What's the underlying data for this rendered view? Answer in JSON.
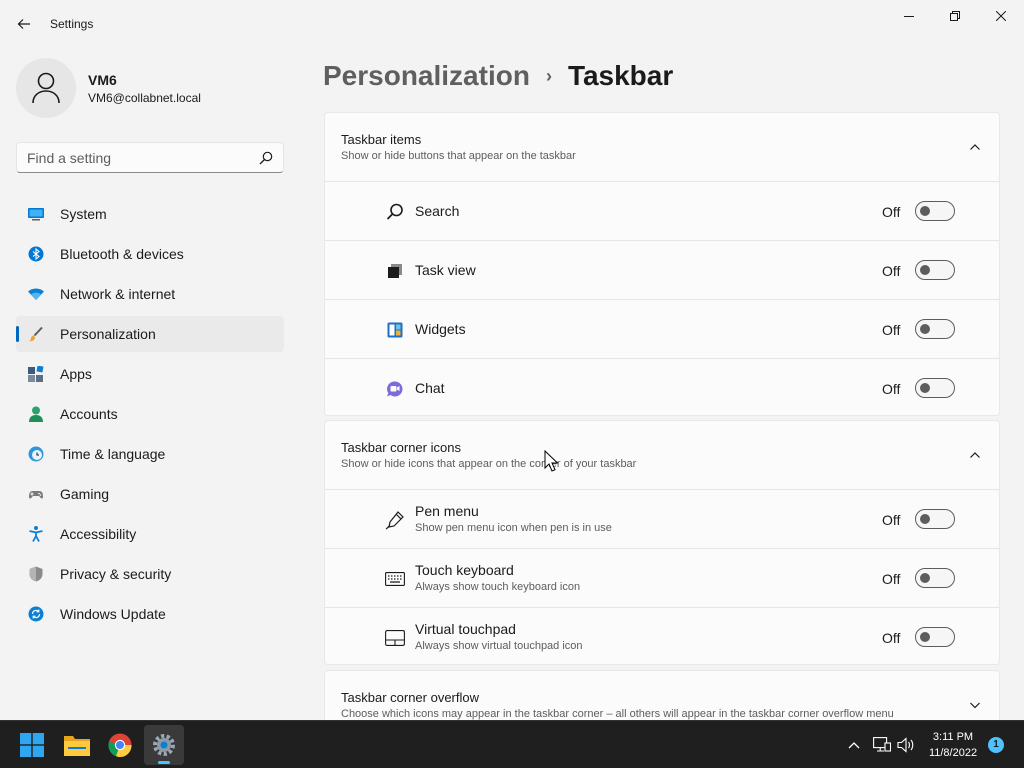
{
  "window": {
    "title": "Settings"
  },
  "profile": {
    "name": "VM6",
    "email": "VM6@collabnet.local"
  },
  "search": {
    "placeholder": "Find a setting"
  },
  "nav": {
    "items": [
      {
        "label": "System",
        "icon": "monitor-icon"
      },
      {
        "label": "Bluetooth & devices",
        "icon": "bluetooth-icon"
      },
      {
        "label": "Network & internet",
        "icon": "wifi-icon"
      },
      {
        "label": "Personalization",
        "icon": "brush-icon",
        "active": true
      },
      {
        "label": "Apps",
        "icon": "apps-icon"
      },
      {
        "label": "Accounts",
        "icon": "person-icon"
      },
      {
        "label": "Time & language",
        "icon": "clock-globe-icon"
      },
      {
        "label": "Gaming",
        "icon": "gamepad-icon"
      },
      {
        "label": "Accessibility",
        "icon": "accessibility-icon"
      },
      {
        "label": "Privacy & security",
        "icon": "shield-icon"
      },
      {
        "label": "Windows Update",
        "icon": "update-icon"
      }
    ]
  },
  "breadcrumb": {
    "parent": "Personalization",
    "separator": "›",
    "current": "Taskbar"
  },
  "sections": {
    "taskbar_items": {
      "title": "Taskbar items",
      "subtitle": "Show or hide buttons that appear on the taskbar",
      "expanded": true,
      "rows": [
        {
          "label": "Search",
          "state": "Off",
          "icon": "search-icon"
        },
        {
          "label": "Task view",
          "state": "Off",
          "icon": "task-view-icon"
        },
        {
          "label": "Widgets",
          "state": "Off",
          "icon": "widgets-icon"
        },
        {
          "label": "Chat",
          "state": "Off",
          "icon": "chat-icon"
        }
      ]
    },
    "corner_icons": {
      "title": "Taskbar corner icons",
      "subtitle": "Show or hide icons that appear on the corner of your taskbar",
      "expanded": true,
      "rows": [
        {
          "label": "Pen menu",
          "description": "Show pen menu icon when pen is in use",
          "state": "Off",
          "icon": "pen-icon"
        },
        {
          "label": "Touch keyboard",
          "description": "Always show touch keyboard icon",
          "state": "Off",
          "icon": "keyboard-icon"
        },
        {
          "label": "Virtual touchpad",
          "description": "Always show virtual touchpad icon",
          "state": "Off",
          "icon": "touchpad-icon"
        }
      ]
    },
    "corner_overflow": {
      "title": "Taskbar corner overflow",
      "subtitle": "Choose which icons may appear in the taskbar corner – all others will appear in the taskbar corner overflow menu",
      "expanded": false
    }
  },
  "taskbar": {
    "apps": [
      "start-icon",
      "file-explorer-icon",
      "chrome-icon",
      "settings-icon"
    ],
    "clock": {
      "time": "3:11 PM",
      "date": "11/8/2022"
    },
    "notification_count": "1"
  },
  "colors": {
    "accent": "#0067c0",
    "background": "#f3f3f3",
    "card": "#fbfbfb",
    "taskbar": "#1f1f1f"
  }
}
